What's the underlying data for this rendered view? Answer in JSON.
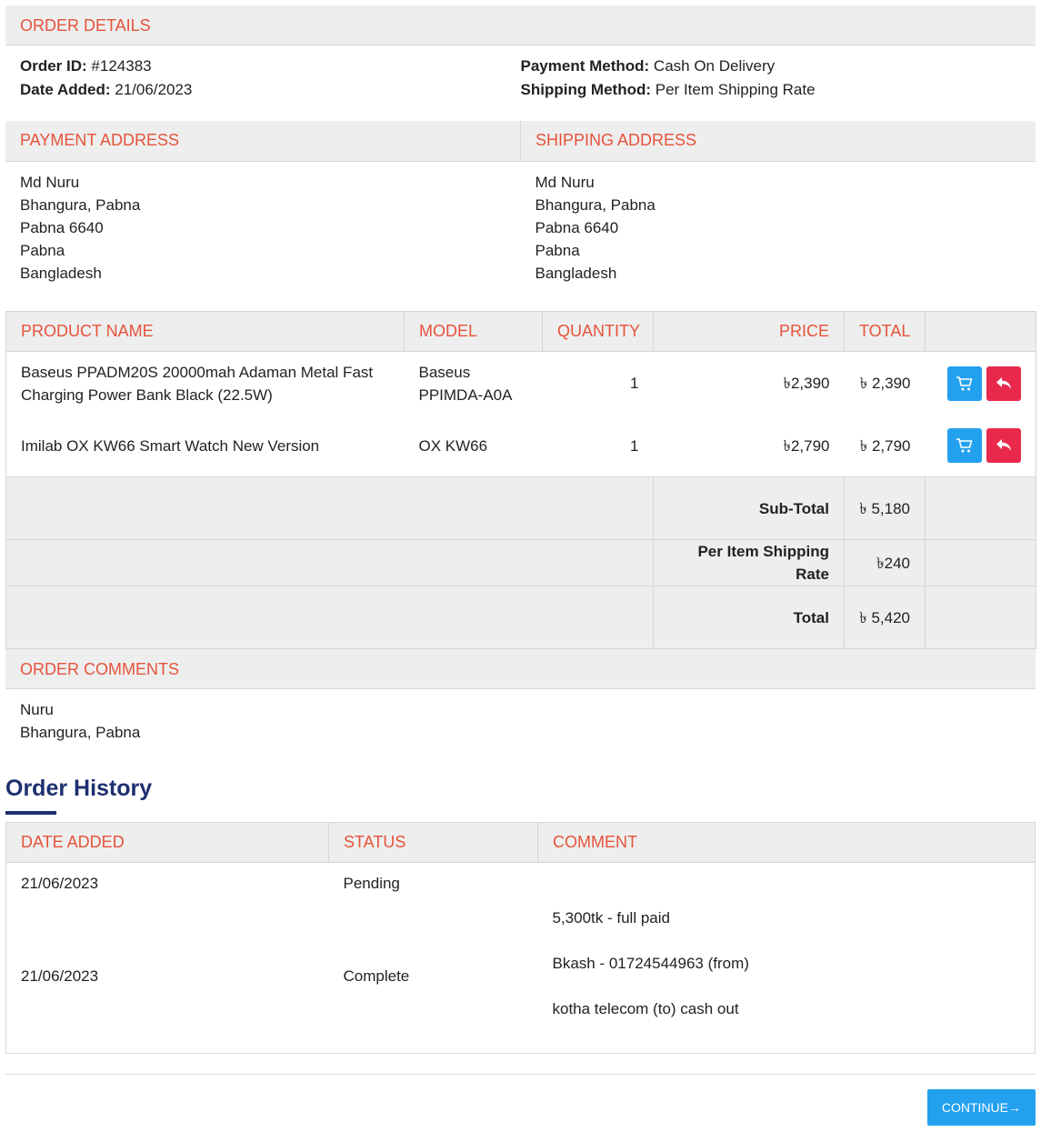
{
  "order_details": {
    "heading": "ORDER DETAILS",
    "order_id_label": "Order ID:",
    "order_id": "#124383",
    "date_added_label": "Date Added:",
    "date_added": "21/06/2023",
    "payment_method_label": "Payment Method:",
    "payment_method": "Cash On Delivery",
    "shipping_method_label": "Shipping Method:",
    "shipping_method": "Per Item Shipping Rate"
  },
  "payment_address": {
    "heading": "PAYMENT ADDRESS",
    "lines": [
      "Md Nuru",
      "Bhangura, Pabna",
      "Pabna 6640",
      "Pabna",
      "Bangladesh"
    ]
  },
  "shipping_address": {
    "heading": "SHIPPING ADDRESS",
    "lines": [
      "Md Nuru",
      "Bhangura, Pabna",
      "Pabna 6640",
      "Pabna",
      "Bangladesh"
    ]
  },
  "products": {
    "headers": {
      "name": "PRODUCT NAME",
      "model": "MODEL",
      "quantity": "QUANTITY",
      "price": "PRICE",
      "total": "TOTAL"
    },
    "rows": [
      {
        "name": "Baseus PPADM20S 20000mah Adaman Metal Fast Charging Power Bank Black (22.5W)",
        "model": "Baseus PPIMDA-A0A",
        "quantity": "1",
        "price": "৳2,390",
        "total": "৳ 2,390"
      },
      {
        "name": "Imilab OX KW66 Smart Watch New Version",
        "model": "OX KW66",
        "quantity": "1",
        "price": "৳2,790",
        "total": "৳ 2,790"
      }
    ],
    "totals": [
      {
        "label": "Sub-Total",
        "value": "৳ 5,180"
      },
      {
        "label": "Per Item Shipping Rate",
        "value": "৳240"
      },
      {
        "label": "Total",
        "value": "৳ 5,420"
      }
    ],
    "icons": {
      "reorder": "cart-icon",
      "return": "return-arrow-icon"
    },
    "colors": {
      "reorder": "#23a1ef",
      "return": "#e8294c"
    }
  },
  "order_comments": {
    "heading": "ORDER COMMENTS",
    "lines": [
      "Nuru",
      "Bhangura, Pabna"
    ]
  },
  "order_history": {
    "title": "Order History",
    "headers": {
      "date": "DATE ADDED",
      "status": "STATUS",
      "comment": "COMMENT"
    },
    "rows": [
      {
        "date": "21/06/2023",
        "status": "Pending",
        "comment": []
      },
      {
        "date": "21/06/2023",
        "status": "Complete",
        "comment": [
          "5,300tk - full paid",
          "Bkash - 01724544963 (from)",
          "kotha telecom (to) cash out"
        ]
      }
    ]
  },
  "continue_button": {
    "label": "CONTINUE",
    "icon": "arrow-right-icon"
  },
  "colors": {
    "accent_red": "#e6533b",
    "heading_blue": "#1d2f6f",
    "button_blue": "#23a1ef"
  }
}
